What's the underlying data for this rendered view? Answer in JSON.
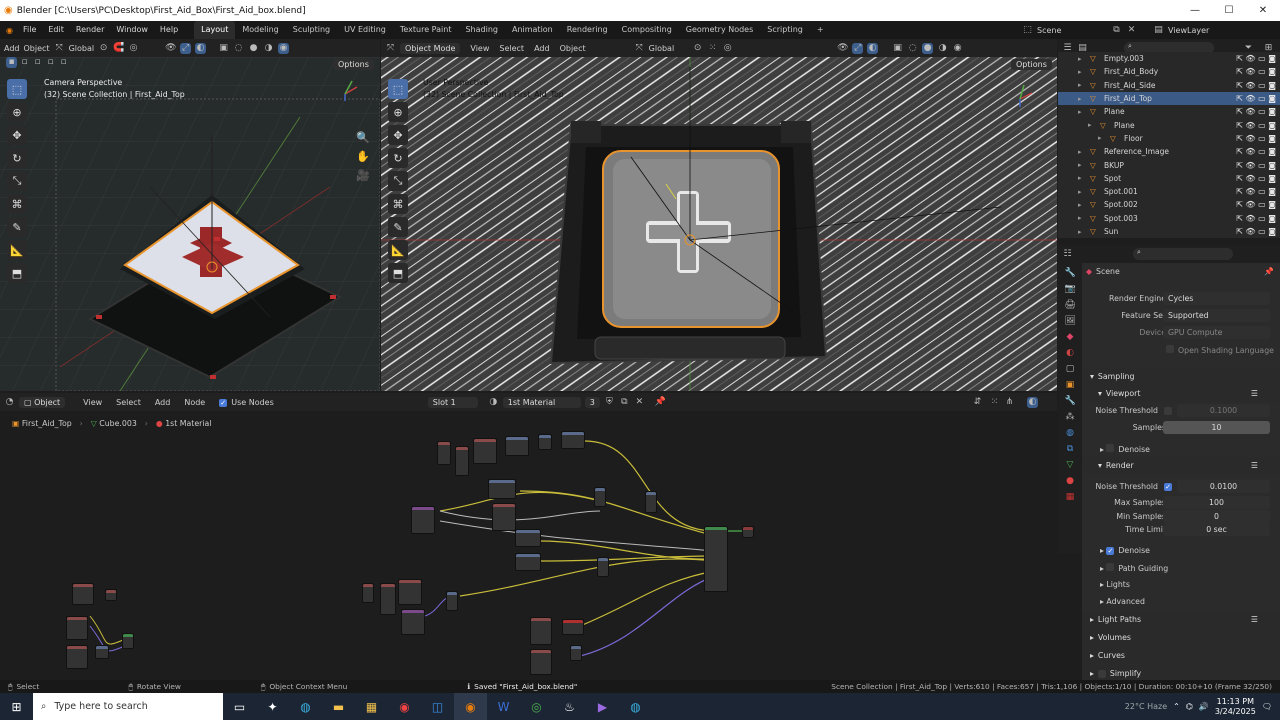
{
  "window": {
    "title": "Blender [C:\\Users\\PC\\Desktop\\First_Aid_Box\\First_Aid_box.blend]",
    "minimize": "—",
    "maximize": "☐",
    "close": "✕"
  },
  "menu": [
    "File",
    "Edit",
    "Render",
    "Window",
    "Help"
  ],
  "workspaces": [
    "Layout",
    "Modeling",
    "Sculpting",
    "UV Editing",
    "Texture Paint",
    "Shading",
    "Animation",
    "Rendering",
    "Compositing",
    "Geometry Nodes",
    "Scripting"
  ],
  "active_workspace": "Layout",
  "scene": {
    "name": "Scene",
    "view_layer": "ViewLayer"
  },
  "viewport_left": {
    "menu": [
      "Add",
      "Object"
    ],
    "orientation": "Global",
    "options": "Options",
    "title": "Camera Perspective",
    "subtitle": "(32) Scene Collection | First_Aid_Top"
  },
  "viewport_right": {
    "mode": "Object Mode",
    "menu": [
      "View",
      "Select",
      "Add",
      "Object"
    ],
    "orientation": "Global",
    "options": "Options",
    "title": "User Perspective",
    "subtitle": "(32) Scene Collection | First_Aid_Top"
  },
  "outliner": {
    "search_placeholder": "",
    "items": [
      {
        "label": "Empty.003",
        "indent": 1,
        "selected": false
      },
      {
        "label": "First_Aid_Body",
        "indent": 1,
        "selected": false
      },
      {
        "label": "First_Aid_Side",
        "indent": 1,
        "selected": false
      },
      {
        "label": "First_Aid_Top",
        "indent": 1,
        "selected": true
      },
      {
        "label": "Plane",
        "indent": 1,
        "selected": false
      },
      {
        "label": "Plane",
        "indent": 2,
        "selected": false
      },
      {
        "label": "Floor",
        "indent": 3,
        "selected": false
      },
      {
        "label": "Reference_Image",
        "indent": 1,
        "selected": false
      },
      {
        "label": "BKUP",
        "indent": 1,
        "selected": false
      },
      {
        "label": "Spot",
        "indent": 1,
        "selected": false
      },
      {
        "label": "Spot.001",
        "indent": 1,
        "selected": false
      },
      {
        "label": "Spot.002",
        "indent": 1,
        "selected": false
      },
      {
        "label": "Spot.003",
        "indent": 1,
        "selected": false
      },
      {
        "label": "Sun",
        "indent": 1,
        "selected": false
      }
    ]
  },
  "properties": {
    "breadcrumb": "Scene",
    "render_engine": {
      "label": "Render Engine",
      "value": "Cycles"
    },
    "feature_set": {
      "label": "Feature Set",
      "value": "Supported"
    },
    "device": {
      "label": "Device",
      "value": "GPU Compute"
    },
    "osl": "Open Shading Language",
    "sampling": "Sampling",
    "viewport": "Viewport",
    "vp_noise": {
      "label": "Noise Threshold",
      "value": "0.1000"
    },
    "vp_samples": {
      "label": "Samples",
      "value": "10"
    },
    "denoise1": "Denoise",
    "render": "Render",
    "r_noise": {
      "label": "Noise Threshold",
      "value": "0.0100"
    },
    "max_samples": {
      "label": "Max Samples",
      "value": "100"
    },
    "min_samples": {
      "label": "Min Samples",
      "value": "0"
    },
    "time_limit": {
      "label": "Time Limit",
      "value": "0 sec"
    },
    "denoise2": "Denoise",
    "path_guiding": "Path Guiding",
    "lights": "Lights",
    "advanced": "Advanced",
    "light_paths": "Light Paths",
    "volumes": "Volumes",
    "curves": "Curves",
    "simplify": "Simplify"
  },
  "node_editor": {
    "type": "Object",
    "menu": [
      "View",
      "Select",
      "Add",
      "Node"
    ],
    "use_nodes": "Use Nodes",
    "slot": "Slot 1",
    "material": "1st Material",
    "users": "3",
    "breadcrumb": [
      "First_Aid_Top",
      "Cube.003",
      "1st Material"
    ]
  },
  "status": {
    "select": "Select",
    "rotate": "Rotate View",
    "context": "Object Context Menu",
    "saved": "Saved \"First_Aid_box.blend\"",
    "stats": "Scene Collection | First_Aid_Top | Verts:610 | Faces:657 | Tris:1,106 | Objects:1/10 | Duration: 00:10+10 (Frame 32/250)"
  },
  "taskbar": {
    "search_placeholder": "Type here to search",
    "weather": "22°C Haze",
    "time": "11:13 PM",
    "date": "3/24/2025"
  },
  "colors": {
    "accent": "#4a7bd8",
    "select_orange": "#e8932c",
    "highlight": "#3c5a86"
  }
}
